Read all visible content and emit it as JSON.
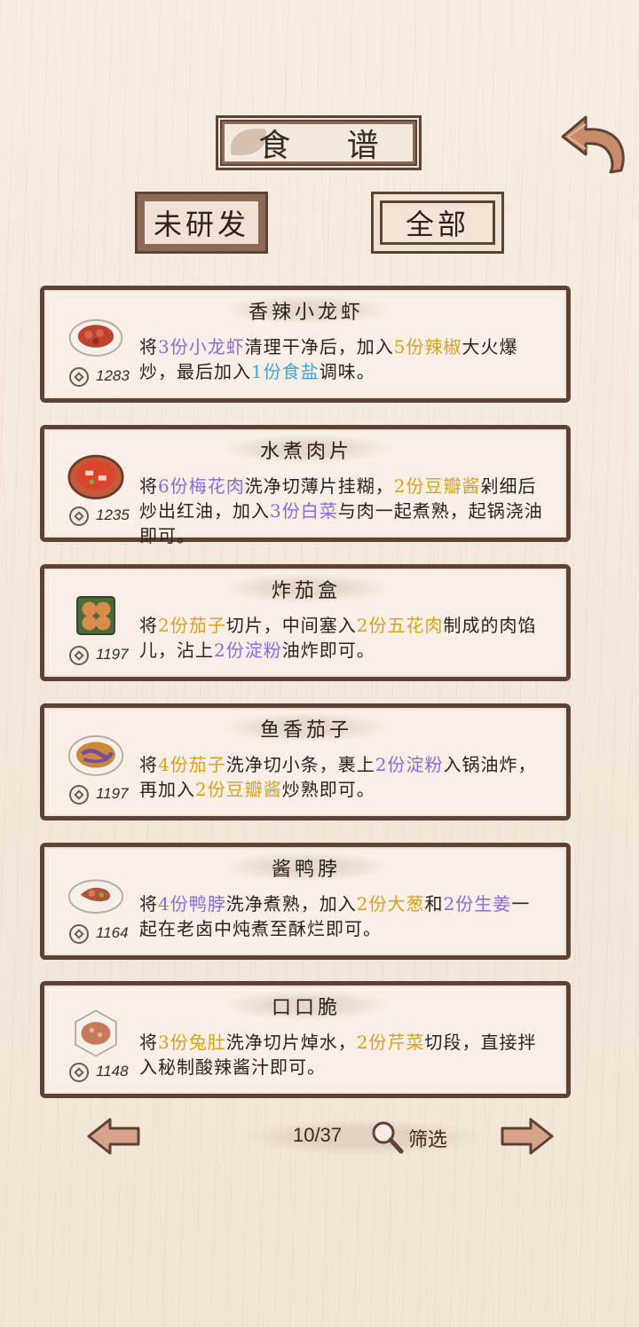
{
  "header": {
    "title": "食 谱",
    "back_icon": "back-arrow-icon"
  },
  "tabs": [
    {
      "label": "未研发",
      "active": false
    },
    {
      "label": "全部",
      "active": true
    }
  ],
  "recipes": [
    {
      "name": "香辣小龙虾",
      "price": "1283",
      "dish_icon": "crayfish-plate-icon",
      "desc": [
        {
          "t": "将",
          "c": ""
        },
        {
          "t": "3份小龙虾",
          "c": "p"
        },
        {
          "t": "清理干净后，加入",
          "c": ""
        },
        {
          "t": "5份辣椒",
          "c": "y"
        },
        {
          "t": "大火爆炒，最后加入",
          "c": ""
        },
        {
          "t": "1份食盐",
          "c": "b"
        },
        {
          "t": "调味。",
          "c": ""
        }
      ]
    },
    {
      "name": "水煮肉片",
      "price": "1235",
      "dish_icon": "boiled-pork-pot-icon",
      "desc": [
        {
          "t": "将",
          "c": ""
        },
        {
          "t": "6份梅花肉",
          "c": "p"
        },
        {
          "t": "洗净切薄片挂糊，",
          "c": ""
        },
        {
          "t": "2份豆瓣酱",
          "c": "y"
        },
        {
          "t": "剁细后炒出红油，加入",
          "c": ""
        },
        {
          "t": "3份白菜",
          "c": "p"
        },
        {
          "t": "与肉一起煮熟，起锅浇油即可。",
          "c": ""
        }
      ]
    },
    {
      "name": "炸茄盒",
      "price": "1197",
      "dish_icon": "fried-eggplant-box-icon",
      "desc": [
        {
          "t": "将",
          "c": ""
        },
        {
          "t": "2份茄子",
          "c": "y"
        },
        {
          "t": "切片，中间塞入",
          "c": ""
        },
        {
          "t": "2份五花肉",
          "c": "y"
        },
        {
          "t": "制成的肉馅儿，沾上",
          "c": ""
        },
        {
          "t": "2份淀粉",
          "c": "p"
        },
        {
          "t": "油炸即可。",
          "c": ""
        }
      ]
    },
    {
      "name": "鱼香茄子",
      "price": "1197",
      "dish_icon": "fish-flavored-eggplant-icon",
      "desc": [
        {
          "t": "将",
          "c": ""
        },
        {
          "t": "4份茄子",
          "c": "y"
        },
        {
          "t": "洗净切小条，裹上",
          "c": ""
        },
        {
          "t": "2份淀粉",
          "c": "p"
        },
        {
          "t": "入锅油炸，再加入",
          "c": ""
        },
        {
          "t": "2份豆瓣酱",
          "c": "y"
        },
        {
          "t": "炒熟即可。",
          "c": ""
        }
      ]
    },
    {
      "name": "酱鸭脖",
      "price": "1164",
      "dish_icon": "duck-neck-plate-icon",
      "desc": [
        {
          "t": "将",
          "c": ""
        },
        {
          "t": "4份鸭脖",
          "c": "p"
        },
        {
          "t": "洗净煮熟，加入",
          "c": ""
        },
        {
          "t": "2份大葱",
          "c": "y"
        },
        {
          "t": "和",
          "c": ""
        },
        {
          "t": "2份生姜",
          "c": "p"
        },
        {
          "t": "一起在老卤中炖煮至酥烂即可。",
          "c": ""
        }
      ]
    },
    {
      "name": "口口脆",
      "price": "1148",
      "dish_icon": "crispy-tripe-plate-icon",
      "desc": [
        {
          "t": "将",
          "c": ""
        },
        {
          "t": "3份兔肚",
          "c": "y"
        },
        {
          "t": "洗净切片焯水，",
          "c": ""
        },
        {
          "t": "2份芹菜",
          "c": "y"
        },
        {
          "t": "切段，直接拌入秘制酸辣酱汁即可。",
          "c": ""
        }
      ]
    }
  ],
  "pager": {
    "page": "10/37",
    "filter_label": "筛选"
  },
  "colors": {
    "frame": "#5d4236",
    "paper": "#f8f0e7",
    "highlight_yellow": "#d9a21c",
    "highlight_purple": "#8a6ad6",
    "highlight_blue": "#3ea4d8"
  }
}
